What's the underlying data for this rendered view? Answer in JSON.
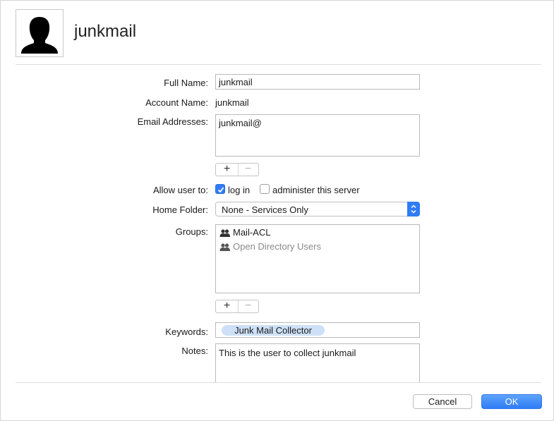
{
  "header": {
    "user_name": "junkmail"
  },
  "form": {
    "full_name": {
      "label": "Full Name:",
      "value": "junkmail"
    },
    "account_name": {
      "label": "Account Name:",
      "value": "junkmail"
    },
    "email": {
      "label": "Email Addresses:",
      "values": [
        "junkmail@"
      ]
    },
    "allow_user": {
      "label": "Allow user to:",
      "options": [
        {
          "label": "log in",
          "checked": true
        },
        {
          "label": "administer this server",
          "checked": false
        }
      ]
    },
    "home_folder": {
      "label": "Home Folder:",
      "value": "None - Services Only"
    },
    "groups": {
      "label": "Groups:",
      "items": [
        {
          "name": "Mail-ACL",
          "dimmed": false
        },
        {
          "name": "Open Directory Users",
          "dimmed": true
        }
      ]
    },
    "keywords": {
      "label": "Keywords:",
      "tokens": [
        "Junk Mail Collector"
      ]
    },
    "notes": {
      "label": "Notes:",
      "value": "This is the user to collect junkmail"
    }
  },
  "list_buttons": {
    "add": "+",
    "remove": "−"
  },
  "footer": {
    "cancel_label": "Cancel",
    "ok_label": "OK"
  },
  "colors": {
    "accent": "#2f7cf6",
    "token_bg": "#cde0f7",
    "dimmed_text": "#8a8a8a"
  },
  "icons": {
    "avatar": "user-silhouette-icon",
    "group": "group-icon",
    "check": "checkmark-icon",
    "popup": "updown-arrows-icon"
  }
}
